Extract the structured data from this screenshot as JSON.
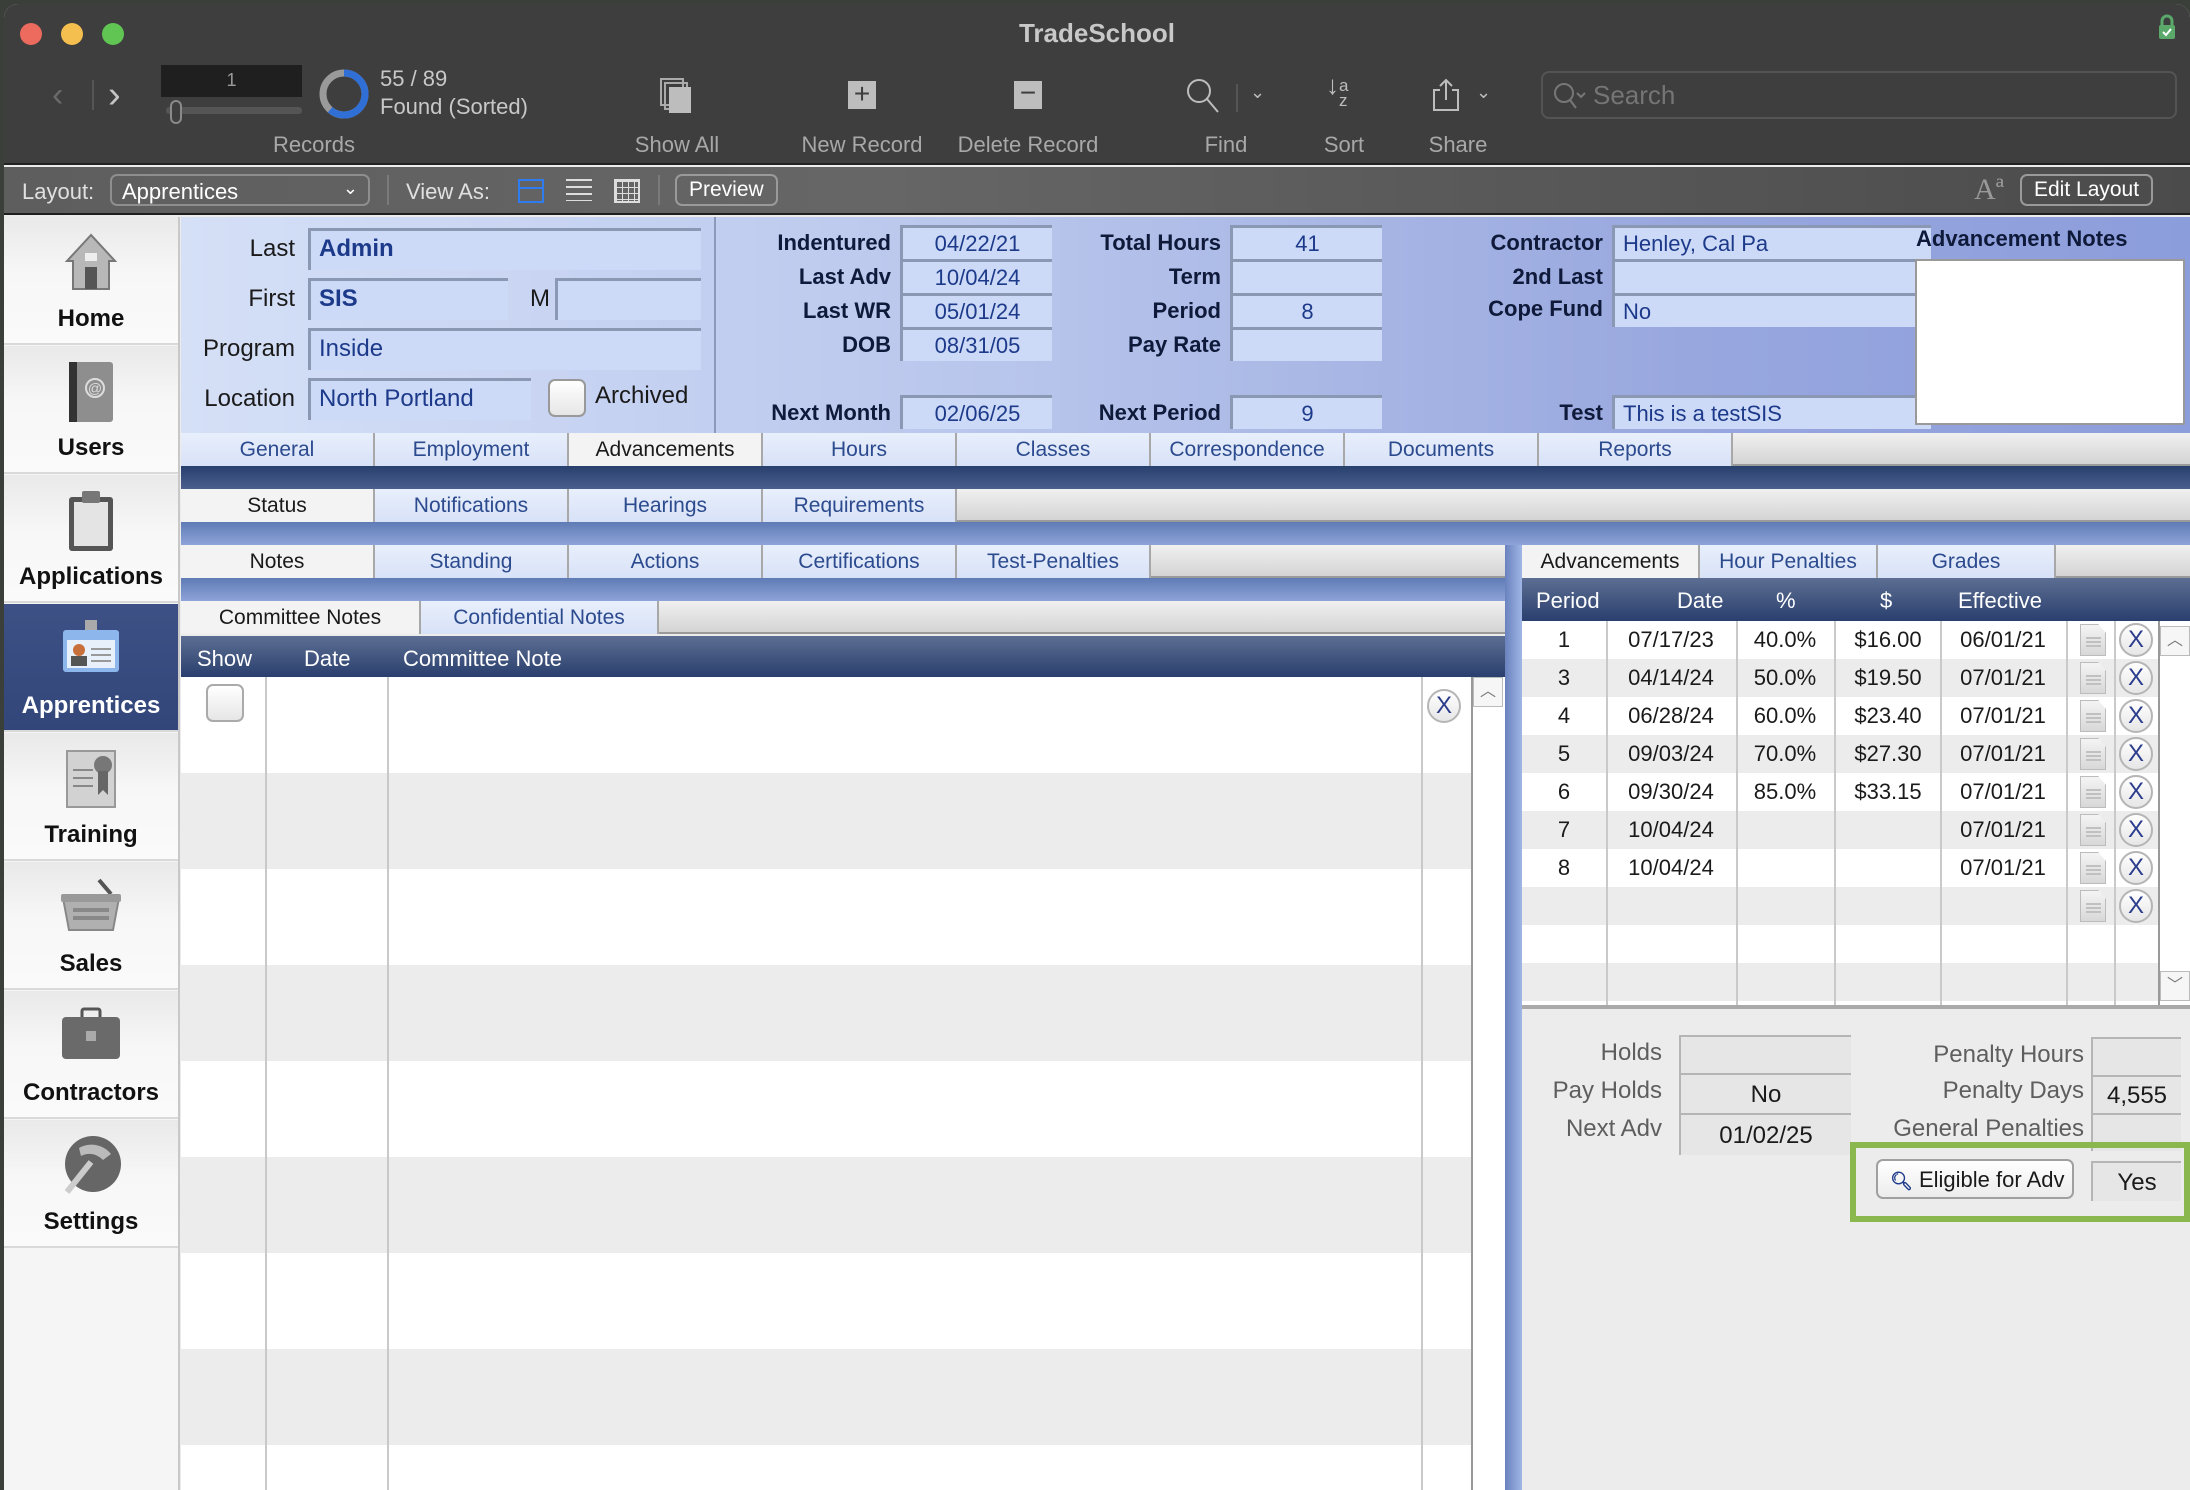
{
  "window": {
    "title": "TradeSchool"
  },
  "toolbar": {
    "record_number": "1",
    "found_count": "55 / 89",
    "found_status": "Found (Sorted)",
    "records_label": "Records",
    "show_all_label": "Show All",
    "new_record_label": "New Record",
    "delete_record_label": "Delete Record",
    "find_label": "Find",
    "sort_label": "Sort",
    "share_label": "Share",
    "search_placeholder": "Search"
  },
  "layoutbar": {
    "layout_label": "Layout:",
    "layout_value": "Apprentices",
    "view_as_label": "View As:",
    "preview_label": "Preview",
    "font_icon_label": "Aª",
    "edit_layout_label": "Edit Layout"
  },
  "sidebar": {
    "items": [
      {
        "label": "Home",
        "icon": "house-icon"
      },
      {
        "label": "Users",
        "icon": "address-book-icon"
      },
      {
        "label": "Applications",
        "icon": "clipboard-icon"
      },
      {
        "label": "Apprentices",
        "icon": "id-badge-icon",
        "active": true
      },
      {
        "label": "Training",
        "icon": "certificate-icon"
      },
      {
        "label": "Sales",
        "icon": "basket-icon"
      },
      {
        "label": "Contractors",
        "icon": "briefcase-icon"
      },
      {
        "label": "Settings",
        "icon": "hammer-globe-icon"
      }
    ]
  },
  "header": {
    "last_label": "Last",
    "last_value": "Admin",
    "first_label": "First",
    "first_value": "SIS",
    "middle_label": "M",
    "middle_value": "",
    "program_label": "Program",
    "program_value": "Inside",
    "location_label": "Location",
    "location_value": "North Portland",
    "archived_label": "Archived",
    "indentured_label": "Indentured",
    "indentured_value": "04/22/21",
    "last_adv_label": "Last Adv",
    "last_adv_value": "10/04/24",
    "last_wr_label": "Last WR",
    "last_wr_value": "05/01/24",
    "dob_label": "DOB",
    "dob_value": "08/31/05",
    "next_month_label": "Next Month",
    "next_month_value": "02/06/25",
    "total_hours_label": "Total Hours",
    "total_hours_value": "41",
    "term_label": "Term",
    "term_value": "",
    "period_label": "Period",
    "period_value": "8",
    "pay_rate_label": "Pay Rate",
    "pay_rate_value": "",
    "next_period_label": "Next Period",
    "next_period_value": "9",
    "contractor_label": "Contractor",
    "contractor_value": "Henley, Cal Pa",
    "second_last_label": "2nd Last",
    "second_last_value": "",
    "cope_fund_label": "Cope Fund",
    "cope_fund_value": "No",
    "test_label": "Test",
    "test_value": "This is a testSIS",
    "advancement_notes_label": "Advancement Notes",
    "advancement_notes_value": ""
  },
  "main_tabs": [
    "General",
    "Employment",
    "Advancements",
    "Hours",
    "Classes",
    "Correspondence",
    "Documents",
    "Reports"
  ],
  "main_tab_active": "Advancements",
  "status_tabs": [
    "Status",
    "Notifications",
    "Hearings",
    "Requirements"
  ],
  "notes_tabs": [
    "Notes",
    "Standing",
    "Actions",
    "Certifications",
    "Test-Penalties"
  ],
  "committee_tabs": [
    "Committee Notes",
    "Confidential Notes"
  ],
  "committee_table": {
    "columns": [
      "Show",
      "Date",
      "Committee Note"
    ]
  },
  "advancement_tabs": [
    "Advancements",
    "Hour Penalties",
    "Grades"
  ],
  "advancements_table": {
    "columns": [
      "Period",
      "Date",
      "%",
      "$",
      "Effective"
    ],
    "rows": [
      {
        "period": "1",
        "date": "07/17/23",
        "pct": "40.0%",
        "amount": "$16.00",
        "effective": "06/01/21"
      },
      {
        "period": "3",
        "date": "04/14/24",
        "pct": "50.0%",
        "amount": "$19.50",
        "effective": "07/01/21"
      },
      {
        "period": "4",
        "date": "06/28/24",
        "pct": "60.0%",
        "amount": "$23.40",
        "effective": "07/01/21"
      },
      {
        "period": "5",
        "date": "09/03/24",
        "pct": "70.0%",
        "amount": "$27.30",
        "effective": "07/01/21"
      },
      {
        "period": "6",
        "date": "09/30/24",
        "pct": "85.0%",
        "amount": "$33.15",
        "effective": "07/01/21"
      },
      {
        "period": "7",
        "date": "10/04/24",
        "pct": "",
        "amount": "",
        "effective": "07/01/21"
      },
      {
        "period": "8",
        "date": "10/04/24",
        "pct": "",
        "amount": "",
        "effective": "07/01/21"
      },
      {
        "period": "",
        "date": "",
        "pct": "",
        "amount": "",
        "effective": ""
      }
    ],
    "delete_glyph": "X"
  },
  "status_fields": {
    "holds_label": "Holds",
    "holds_value": "",
    "pay_holds_label": "Pay Holds",
    "pay_holds_value": "No",
    "next_adv_label": "Next Adv",
    "next_adv_value": "01/02/25",
    "penalty_hours_label": "Penalty Hours",
    "penalty_hours_value": "",
    "penalty_days_label": "Penalty Days",
    "penalty_days_value": "4,555",
    "general_penalties_label": "General Penalties",
    "general_penalties_value": "",
    "eligible_button_label": "Eligible for Adv",
    "eligible_value": "Yes"
  },
  "colors": {
    "highlight_box": "#8ab84f",
    "active_sidebar": "#3a4d82",
    "field_text": "#1d3a8a",
    "lock_green": "#5aa86a"
  }
}
